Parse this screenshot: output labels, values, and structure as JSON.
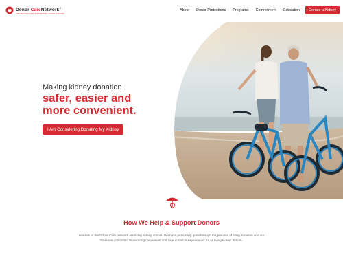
{
  "brand": {
    "name_part1": "Donor ",
    "name_part2": "Care",
    "name_part3": "Network",
    "trademark": "®",
    "tagline": "PROTECTING AND SUPPORTING LIVING DONORS",
    "logo_icon": "kidney-shield-icon"
  },
  "nav": {
    "items": [
      "About",
      "Donor Protections",
      "Programs",
      "Commitment",
      "Education"
    ],
    "cta": "Donate a Kidney"
  },
  "hero": {
    "lead": "Making kidney donation",
    "emphasis_line1": "safer, easier and",
    "emphasis_line2": "more convenient.",
    "button": "I Am Considering Donating My Kidney"
  },
  "section": {
    "icon": "umbrella-kidney-icon",
    "title": "How We Help & Support Donors",
    "body_line1": "Leaders of the Donor Care Network are living kidney donors. We have personally gone through the process of living donation and are",
    "body_line2": "therefore committed to ensuring convenient and safe donation experiences for all living kidney donors."
  },
  "colors": {
    "accent": "#d62b33",
    "text": "#333333",
    "muted": "#666666"
  }
}
